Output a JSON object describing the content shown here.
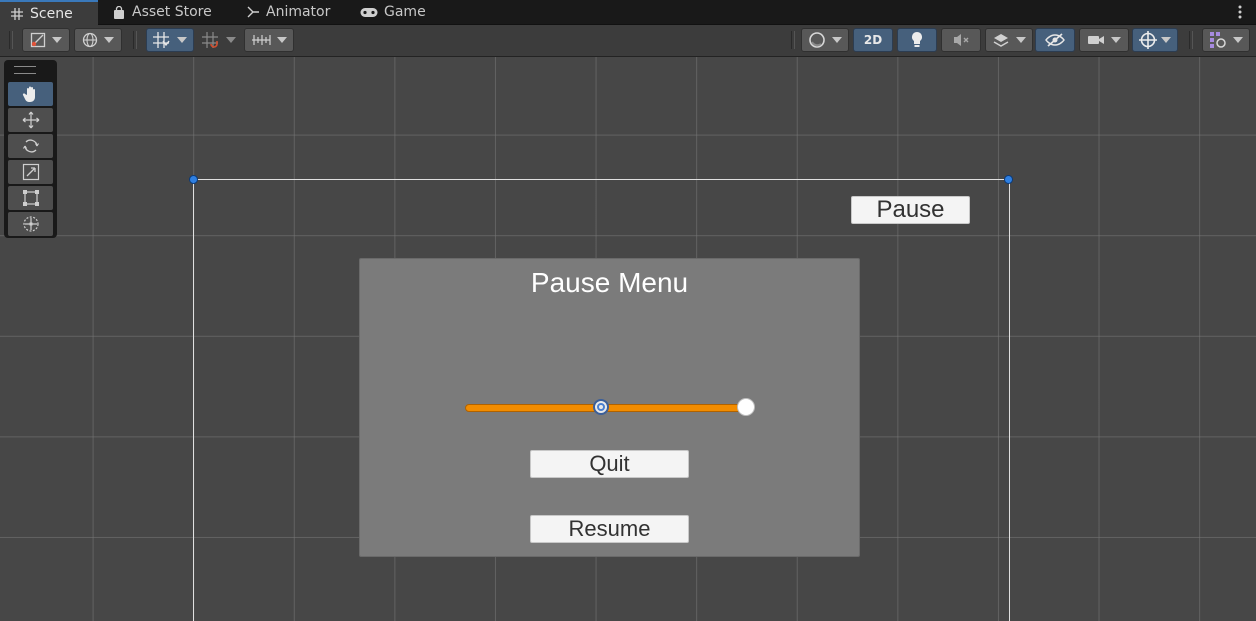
{
  "tabs": [
    {
      "label": "Scene",
      "icon": "grid-icon",
      "active": true
    },
    {
      "label": "Asset Store",
      "icon": "shopping-bag-icon",
      "active": false
    },
    {
      "label": "Animator",
      "icon": "animator-icon",
      "active": false
    },
    {
      "label": "Game",
      "icon": "gamepad-icon",
      "active": false
    }
  ],
  "toolbar": {
    "toggle_2d_label": "2D"
  },
  "scene": {
    "pause_button_label": "Pause",
    "pause_menu": {
      "title": "Pause Menu",
      "slider_value_fraction": 0.48,
      "quit_label": "Quit",
      "resume_label": "Resume"
    }
  },
  "colors": {
    "accent": "#3a79bb",
    "slider_fill": "#f28c00",
    "panel_bg": "#7b7b7b",
    "viewport_bg": "#474747"
  }
}
